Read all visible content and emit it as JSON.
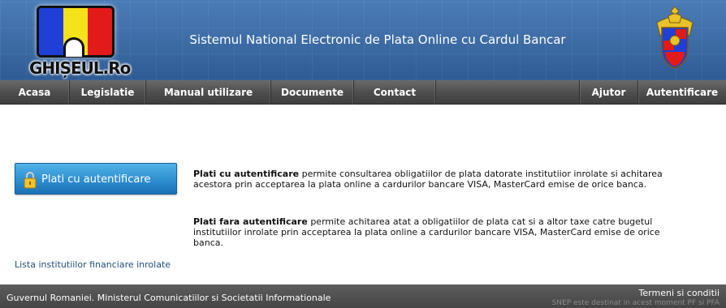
{
  "header": {
    "logo_text": "GHIȘEUL.Ro",
    "site_title": "Sistemul National Electronic de Plata Online cu Cardul Bancar",
    "logo_icon": "ghiseul-logo",
    "coat_icon": "romania-coat-of-arms-icon"
  },
  "nav": {
    "items": [
      {
        "label": "Acasa"
      },
      {
        "label": "Legislatie"
      },
      {
        "label": "Manual utilizare"
      },
      {
        "label": "Documente"
      },
      {
        "label": "Contact"
      }
    ],
    "right_items": [
      {
        "label": "Ajutor"
      },
      {
        "label": "Autentificare"
      }
    ]
  },
  "main": {
    "login_button_label": "Plati cu autentificare",
    "login_button_icon": "lock-icon",
    "para1_bold": "Plati cu autentificare",
    "para1_text": " permite consultarea obligatiilor de plata datorate institutiior inrolate si achitarea acestora prin acceptarea la plata online a cardurilor bancare VISA, MasterCard emise de orice banca.",
    "para2_bold": "Plati fara autentificare",
    "para2_text": " permite achitarea atat a obligatiilor de plata cat si a altor taxe catre bugetul institutiilor inrolate prin acceptarea la plata online a cardurilor bancare VISA, MasterCard emise de orice banca.",
    "institutions_link": "Lista institutiilor financiare inrolate"
  },
  "footer": {
    "left_text": "Guvernul Romaniei. Ministerul Comunicatiilor si Societatii Informationale",
    "terms_link": "Termeni si conditii",
    "note": "SNEP este destinat in acest moment PF si PFA"
  },
  "colors": {
    "header_blue": "#3f6ea8",
    "nav_gray": "#4f4f4f",
    "button_blue": "#2e8fd0",
    "link_blue": "#1f4f7a",
    "flag_blue": "#1f3fd6",
    "flag_yellow": "#f4e21a",
    "flag_red": "#e21a1a"
  }
}
